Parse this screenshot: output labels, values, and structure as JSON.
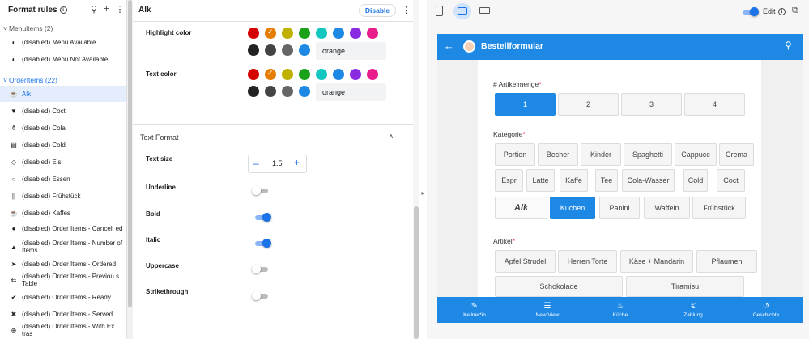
{
  "sidebar": {
    "title": "Format rules",
    "groups": [
      {
        "label": "Menultems (2)"
      },
      {
        "label": "OrderItems (22)"
      }
    ],
    "items": [
      {
        "label": "(disabled) Menu Available"
      },
      {
        "label": "(disabled) Menu Not Available"
      },
      {
        "label": "Alk"
      },
      {
        "label": "(disabled) Coct"
      },
      {
        "label": "(disabled) Cola"
      },
      {
        "label": "(disabled) Cold"
      },
      {
        "label": "(disabled) Eis"
      },
      {
        "label": "(disabled) Essen"
      },
      {
        "label": "(disabled) Frühstück"
      },
      {
        "label": "(disabled) Kaffes"
      },
      {
        "label": "(disabled) Order Items - Cancell ed"
      },
      {
        "label": "(disabled) Order Items - Number of Items"
      },
      {
        "label": "(disabled) Order Items - Ordered"
      },
      {
        "label": "(disabled) Order Items - Previou s Table"
      },
      {
        "label": "(disabled) Order Items - Ready"
      },
      {
        "label": "(disabled) Order Items - Served"
      },
      {
        "label": "(disabled) Order Items - With Ex tras"
      }
    ]
  },
  "editor": {
    "title": "Alk",
    "disable_label": "Disable",
    "highlight_label": "Highlight color",
    "highlight_value": "orange",
    "text_color_label": "Text color",
    "text_color_value": "orange",
    "text_format_label": "Text Format",
    "text_size_label": "Text size",
    "text_size_value": "1.5",
    "underline_label": "Underline",
    "bold_label": "Bold",
    "italic_label": "Italic",
    "uppercase_label": "Uppercase",
    "strikethrough_label": "Strikethrough",
    "underline_on": false,
    "bold_on": true,
    "italic_on": true,
    "uppercase_on": false,
    "strikethrough_on": false,
    "palette": [
      "#d50000",
      "#e67c00",
      "#c0b000",
      "#1aa31a",
      "#12c7c0",
      "#1e88e5",
      "#8a2be2",
      "#e91e8c",
      "#222222",
      "#444444",
      "#666666",
      "#1e88e5"
    ],
    "accent": "#1a73e8"
  },
  "preview": {
    "edit_label": "Edit",
    "app_title": "Bestellformular",
    "qty_label": "# Artikelmenge",
    "qty_options": [
      "1",
      "2",
      "3",
      "4"
    ],
    "qty_selected": "1",
    "kategorie_label": "Kategorie",
    "kategorie_row1": [
      "Portion",
      "Becher",
      "Kinder",
      "Spaghetti",
      "Cappucc",
      "Crema"
    ],
    "kategorie_row2": [
      "Espr",
      "Latte",
      "Kaffe",
      "Tee",
      "Cola-Wasser",
      "Cold",
      "Coct"
    ],
    "kategorie_row3": [
      "Alk",
      "Kuchen",
      "Panini",
      "Waffeln",
      "Frühstück"
    ],
    "kategorie_selected": "Kuchen",
    "artikel_label": "Artikel",
    "artikel_row1": [
      "Apfel Strudel",
      "Herren Torte",
      "Käse + Mandarin",
      "Pflaumen"
    ],
    "artikel_row2": [
      "Schokolade",
      "Tiramisu"
    ],
    "nav": [
      "Kellner*in",
      "New View",
      "Küche",
      "Zahlung",
      "Geschichte"
    ],
    "brand": "#1e88e5"
  }
}
